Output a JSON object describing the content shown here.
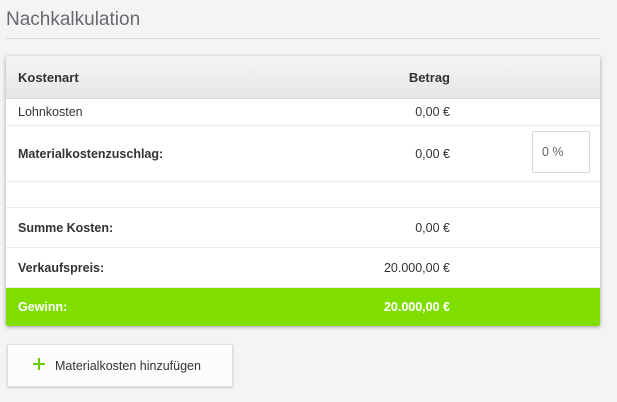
{
  "page": {
    "title": "Nachkalkulation"
  },
  "table": {
    "headers": {
      "kostenart": "Kostenart",
      "betrag": "Betrag"
    },
    "rows": {
      "lohnkosten": {
        "label": "Lohnkosten",
        "amount": "0,00 €"
      },
      "materialzuschlag": {
        "label": "Materialkostenzuschlag:",
        "amount": "0,00 €",
        "percent_value": "0 %"
      },
      "summe": {
        "label": "Summe Kosten:",
        "amount": "0,00 €"
      },
      "verkaufspreis": {
        "label": "Verkaufspreis:",
        "amount": "20.000,00 €"
      },
      "gewinn": {
        "label": "Gewinn:",
        "amount": "20.000,00 €"
      }
    }
  },
  "actions": {
    "add_material_label": "Materialkosten hinzufügen",
    "add_icon": "plus-icon"
  },
  "colors": {
    "profit_row": "#80dd00",
    "plus_icon": "#66cc00",
    "title": "#666a70"
  }
}
